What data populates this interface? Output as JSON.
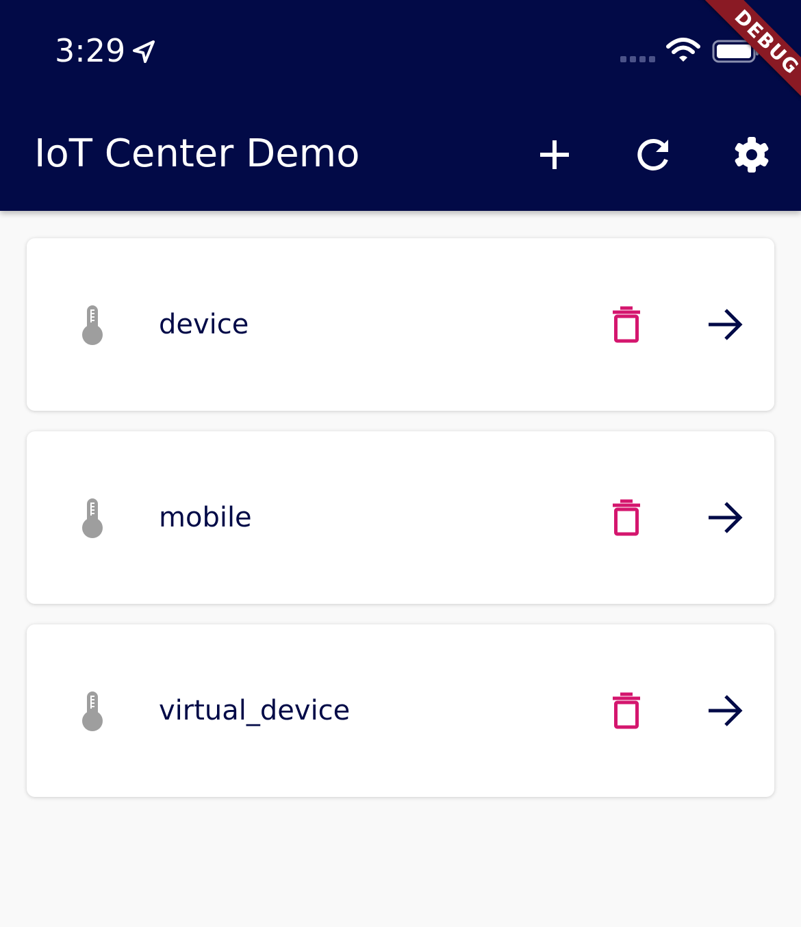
{
  "status_bar": {
    "time": "3:29",
    "location_icon": "location-arrow-icon",
    "signal_icon": "cellular-signal-icon",
    "wifi_icon": "wifi-icon",
    "battery_icon": "battery-icon"
  },
  "debug_banner": "DEBUG",
  "app_bar": {
    "title": "IoT Center Demo",
    "actions": [
      {
        "icon": "plus-icon"
      },
      {
        "icon": "refresh-icon"
      },
      {
        "icon": "gear-icon"
      }
    ],
    "background_color": "#020a47"
  },
  "devices": [
    {
      "name": "device",
      "icon": "thermometer-icon"
    },
    {
      "name": "mobile",
      "icon": "thermometer-icon"
    },
    {
      "name": "virtual_device",
      "icon": "thermometer-icon"
    }
  ],
  "colors": {
    "delete": "#d4166e",
    "arrow": "#020a47",
    "thermometer": "#9e9e9e",
    "text": "#020a47"
  }
}
